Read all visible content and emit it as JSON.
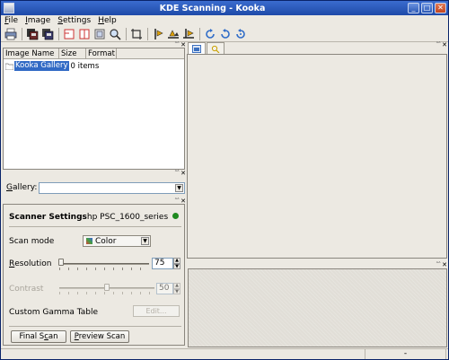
{
  "window": {
    "title": "KDE Scanning - Kooka",
    "buttons": [
      "_",
      "□",
      "✕"
    ]
  },
  "menubar": {
    "items": [
      {
        "accel": "F",
        "rest": "ile"
      },
      {
        "accel": "I",
        "rest": "mage"
      },
      {
        "accel": "S",
        "rest": "ettings"
      },
      {
        "accel": "H",
        "rest": "elp"
      }
    ]
  },
  "toolbar": {
    "icons": [
      "print-icon",
      "save-image-icon",
      "save-as-icon",
      "rotate-image-icon",
      "flip-image-icon",
      "zoom-icon",
      "crop-icon",
      "mirror-horizontal-icon",
      "mirror-vertical-icon",
      "mirror-both-icon",
      "rotate-clockwise-icon",
      "rotate-counterclockwise-icon",
      "rotate-180-icon"
    ]
  },
  "imagelist": {
    "columns": [
      "Image Name",
      "Size",
      "Format"
    ],
    "rows": [
      {
        "name": "Kooka Gallery",
        "size": "0 items",
        "format": ""
      }
    ]
  },
  "gallery": {
    "label_accel": "G",
    "label_rest": "allery:",
    "value": ""
  },
  "scanner": {
    "heading": "Scanner Settings",
    "device": "hp PSC_1600_series",
    "status_color": "#1f8a1f",
    "scan_mode_label": "Scan mode",
    "scan_mode_value": "Color",
    "resolution_accel": "R",
    "resolution_rest": "esolution",
    "resolution_value": "75",
    "contrast_label": "Contrast",
    "contrast_value": "50",
    "gamma_label": "Custom Gamma Table",
    "edit_label": "Edit...",
    "final_scan_pre": "Final S",
    "final_scan_accel": "c",
    "final_scan_post": "an",
    "preview_scan_accel": "P",
    "preview_scan_rest": "review Scan"
  },
  "statusbar": {
    "dash": "-"
  }
}
